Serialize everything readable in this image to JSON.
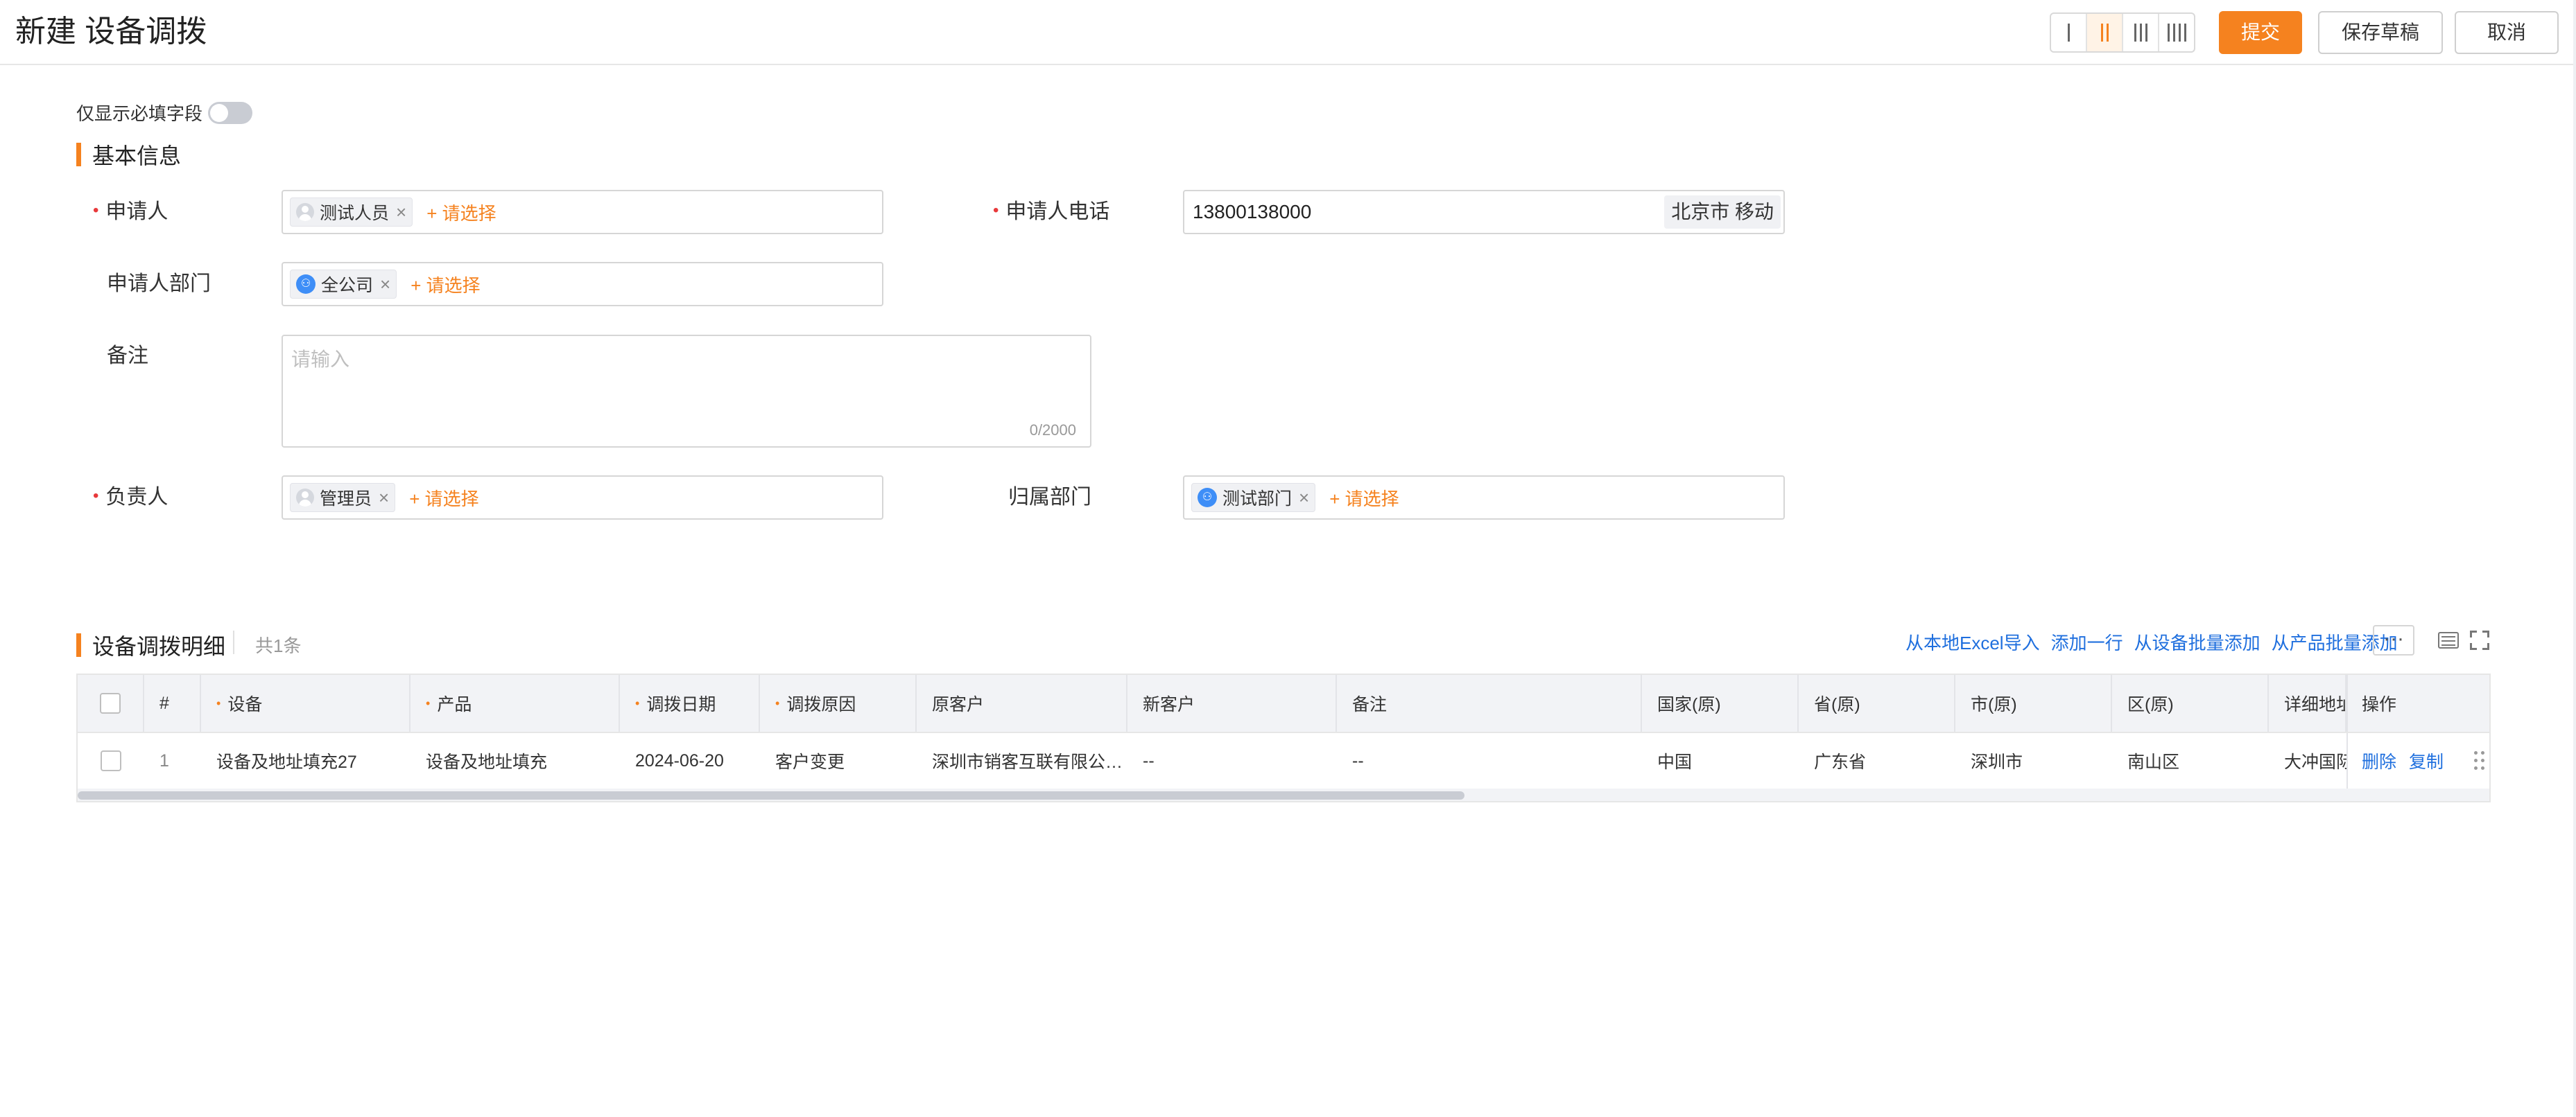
{
  "header": {
    "title": "新建 设备调拨",
    "layout_options": [
      "single-column",
      "two-column",
      "three-column",
      "four-column"
    ],
    "active_layout": "two-column",
    "submit_label": "提交",
    "save_draft_label": "保存草稿",
    "cancel_label": "取消"
  },
  "toggle": {
    "label": "仅显示必填字段",
    "checked": false
  },
  "basic_info": {
    "section_title": "基本信息",
    "applicant_label": "申请人",
    "applicant_value": "测试人员",
    "applicant_add": "+ 请选择",
    "phone_label": "申请人电话",
    "phone_value": "13800138000",
    "phone_location": "北京市 移动",
    "dept_label": "申请人部门",
    "dept_value": "全公司",
    "dept_add": "+ 请选择",
    "remark_label": "备注",
    "remark_placeholder": "请输入",
    "remark_count": "0/2000",
    "owner_label": "负责人",
    "owner_value": "管理员",
    "owner_add": "+ 请选择",
    "owner_dept_label": "归属部门",
    "owner_dept_value": "测试部门",
    "owner_dept_add": "+ 请选择"
  },
  "detail": {
    "section_title": "设备调拨明细",
    "count_label": "共1条",
    "tools": [
      "从本地Excel导入",
      "添加一行",
      "从设备批量添加",
      "从产品批量添加"
    ],
    "more_label": "···",
    "columns": [
      {
        "label": "#",
        "required": false
      },
      {
        "label": "设备",
        "required": true
      },
      {
        "label": "产品",
        "required": true
      },
      {
        "label": "调拨日期",
        "required": true
      },
      {
        "label": "调拨原因",
        "required": true
      },
      {
        "label": "原客户",
        "required": false
      },
      {
        "label": "新客户",
        "required": false
      },
      {
        "label": "备注",
        "required": false
      },
      {
        "label": "国家(原)",
        "required": false
      },
      {
        "label": "省(原)",
        "required": false
      },
      {
        "label": "市(原)",
        "required": false
      },
      {
        "label": "区(原)",
        "required": false
      },
      {
        "label": "详细地址",
        "required": false
      },
      {
        "label": "操作",
        "required": false
      }
    ],
    "rows": [
      {
        "index": "1",
        "device": "设备及地址填充27",
        "product": "设备及地址填充",
        "date": "2024-06-20",
        "reason": "客户变更",
        "old_customer": "深圳市销客互联有限公…",
        "new_customer": "--",
        "remark": "--",
        "country": "中国",
        "province": "广东省",
        "city": "深圳市",
        "district": "南山区",
        "address": "大冲国际",
        "delete_label": "删除",
        "copy_label": "复制"
      }
    ]
  },
  "colors": {
    "accent": "#f5821f",
    "link": "#1f6fde",
    "required": "#e8393b"
  }
}
